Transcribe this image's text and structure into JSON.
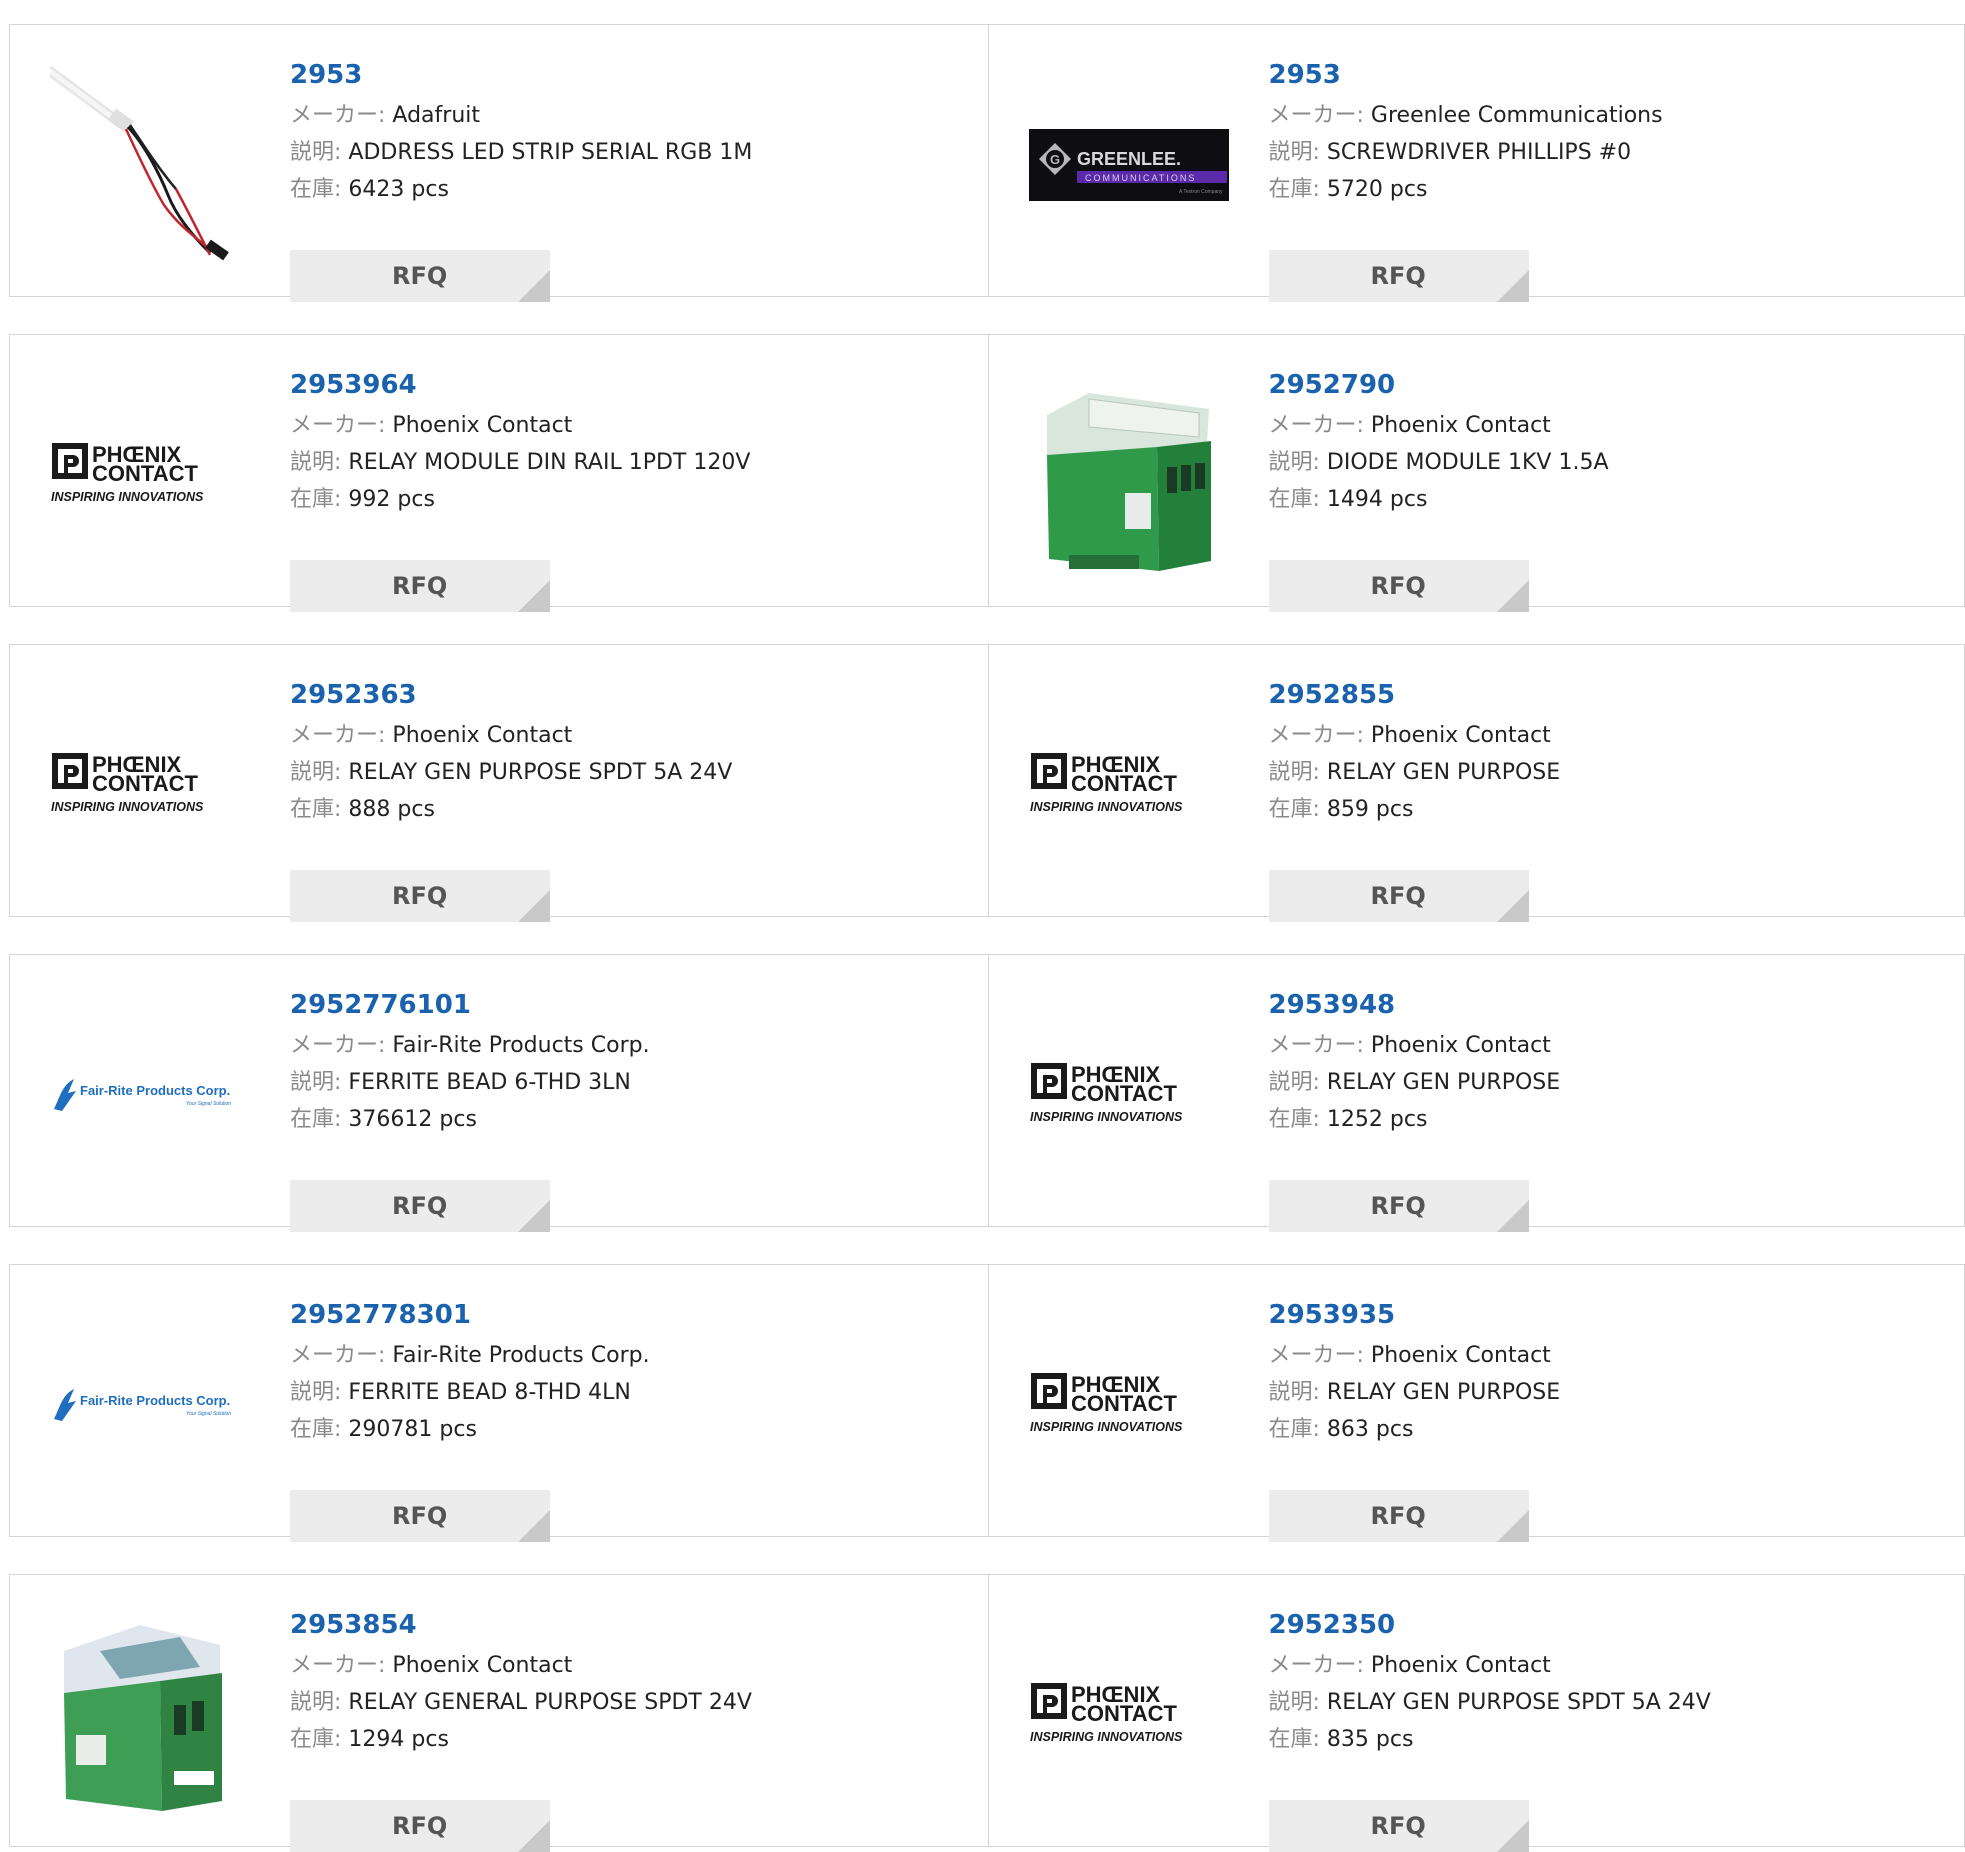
{
  "labels": {
    "maker": "メーカー:",
    "desc": "説明:",
    "stock": "在庫:",
    "rfq": "RFQ"
  },
  "logos": {
    "phoenix_line1": "PHŒNIX",
    "phoenix_line2": "CONTACT",
    "phoenix_tagline": "INSPIRING INNOVATIONS",
    "greenlee_name": "GREENLEE.",
    "greenlee_sub": "COMMUNICATIONS",
    "greenlee_textron": "A Textron Company",
    "fairrite_name": "Fair-Rite Products Corp.",
    "fairrite_sub": "Your Signal Solution"
  },
  "colors": {
    "part_link": "#1a62ad",
    "label_gray": "#8a8a8a",
    "rfq_bg": "#ececec",
    "border": "#d4d4d4"
  },
  "products": [
    [
      {
        "part": "2953",
        "maker": "Adafruit",
        "desc": "ADDRESS LED STRIP SERIAL RGB 1M",
        "stock": "6423 pcs",
        "image": "led-strip-photo"
      },
      {
        "part": "2953",
        "maker": "Greenlee Communications",
        "desc": "SCREWDRIVER PHILLIPS #0",
        "stock": "5720 pcs",
        "image": "greenlee-logo"
      }
    ],
    [
      {
        "part": "2953964",
        "maker": "Phoenix Contact",
        "desc": "RELAY MODULE DIN RAIL 1PDT 120V",
        "stock": "992 pcs",
        "image": "phoenix-contact-logo"
      },
      {
        "part": "2952790",
        "maker": "Phoenix Contact",
        "desc": "DIODE MODULE 1KV 1.5A",
        "stock": "1494 pcs",
        "image": "din-module-photo"
      }
    ],
    [
      {
        "part": "2952363",
        "maker": "Phoenix Contact",
        "desc": "RELAY GEN PURPOSE SPDT 5A 24V",
        "stock": "888 pcs",
        "image": "phoenix-contact-logo"
      },
      {
        "part": "2952855",
        "maker": "Phoenix Contact",
        "desc": "RELAY GEN PURPOSE",
        "stock": "859 pcs",
        "image": "phoenix-contact-logo"
      }
    ],
    [
      {
        "part": "2952776101",
        "maker": "Fair-Rite Products Corp.",
        "desc": "FERRITE BEAD 6-THD 3LN",
        "stock": "376612 pcs",
        "image": "fair-rite-logo"
      },
      {
        "part": "2953948",
        "maker": "Phoenix Contact",
        "desc": "RELAY GEN PURPOSE",
        "stock": "1252 pcs",
        "image": "phoenix-contact-logo"
      }
    ],
    [
      {
        "part": "2952778301",
        "maker": "Fair-Rite Products Corp.",
        "desc": "FERRITE BEAD 8-THD 4LN",
        "stock": "290781 pcs",
        "image": "fair-rite-logo"
      },
      {
        "part": "2953935",
        "maker": "Phoenix Contact",
        "desc": "RELAY GEN PURPOSE",
        "stock": "863 pcs",
        "image": "phoenix-contact-logo"
      }
    ],
    [
      {
        "part": "2953854",
        "maker": "Phoenix Contact",
        "desc": "RELAY GENERAL PURPOSE SPDT 24V",
        "stock": "1294 pcs",
        "image": "relay-module-photo"
      },
      {
        "part": "2952350",
        "maker": "Phoenix Contact",
        "desc": "RELAY GEN PURPOSE SPDT 5A 24V",
        "stock": "835 pcs",
        "image": "phoenix-contact-logo"
      }
    ]
  ]
}
